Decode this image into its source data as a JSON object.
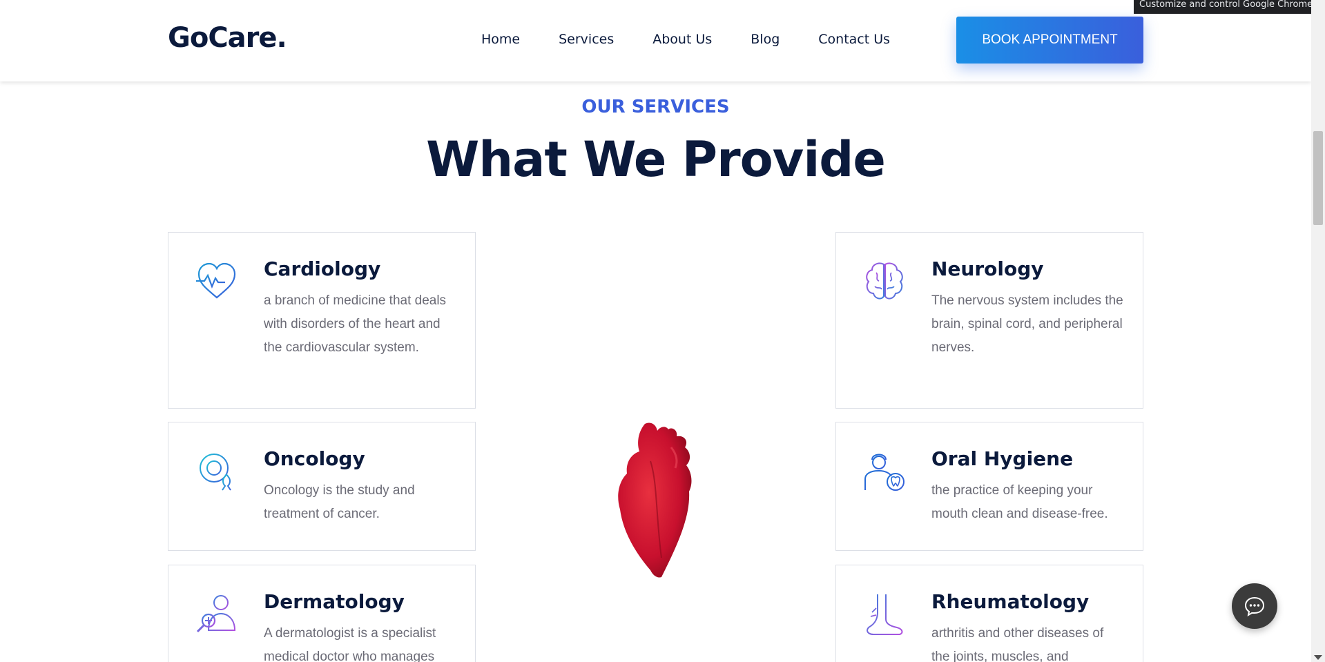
{
  "tooltip": {
    "text": "Customize and control Google Chrome"
  },
  "header": {
    "logo": "GoCare.",
    "nav": [
      "Home",
      "Services",
      "About Us",
      "Blog",
      "Contact Us"
    ],
    "cta": "BOOK APPOINTMENT"
  },
  "section": {
    "eyebrow": "OUR SERVICES",
    "title": "What We Provide"
  },
  "services": [
    {
      "title": "Cardiology",
      "desc": "a branch of medicine that deals with disorders of the heart and the cardiovascular system.",
      "icon": "heart-pulse-icon"
    },
    {
      "title": "Oncology",
      "desc": "Oncology is the study and treatment of cancer.",
      "icon": "oncology-ribbon-icon"
    },
    {
      "title": "Dermatology",
      "desc": "A dermatologist is a specialist medical doctor who manages",
      "icon": "dermatologist-icon"
    },
    {
      "title": "Neurology",
      "desc": "The nervous system includes the brain, spinal cord, and peripheral nerves.",
      "icon": "brain-icon"
    },
    {
      "title": "Oral Hygiene",
      "desc": "the practice of keeping your mouth clean and disease-free.",
      "icon": "dentist-icon"
    },
    {
      "title": "Rheumatology",
      "desc": "arthritis and other diseases of the joints, muscles, and",
      "icon": "foot-joint-icon"
    }
  ],
  "colors": {
    "accent": "#3a5fdc",
    "cta_gradient_start": "#1a8fe6",
    "navy": "#0b1a3c",
    "heart_red": "#c8102e"
  },
  "chat": {
    "icon": "chat-bubble-icon"
  }
}
